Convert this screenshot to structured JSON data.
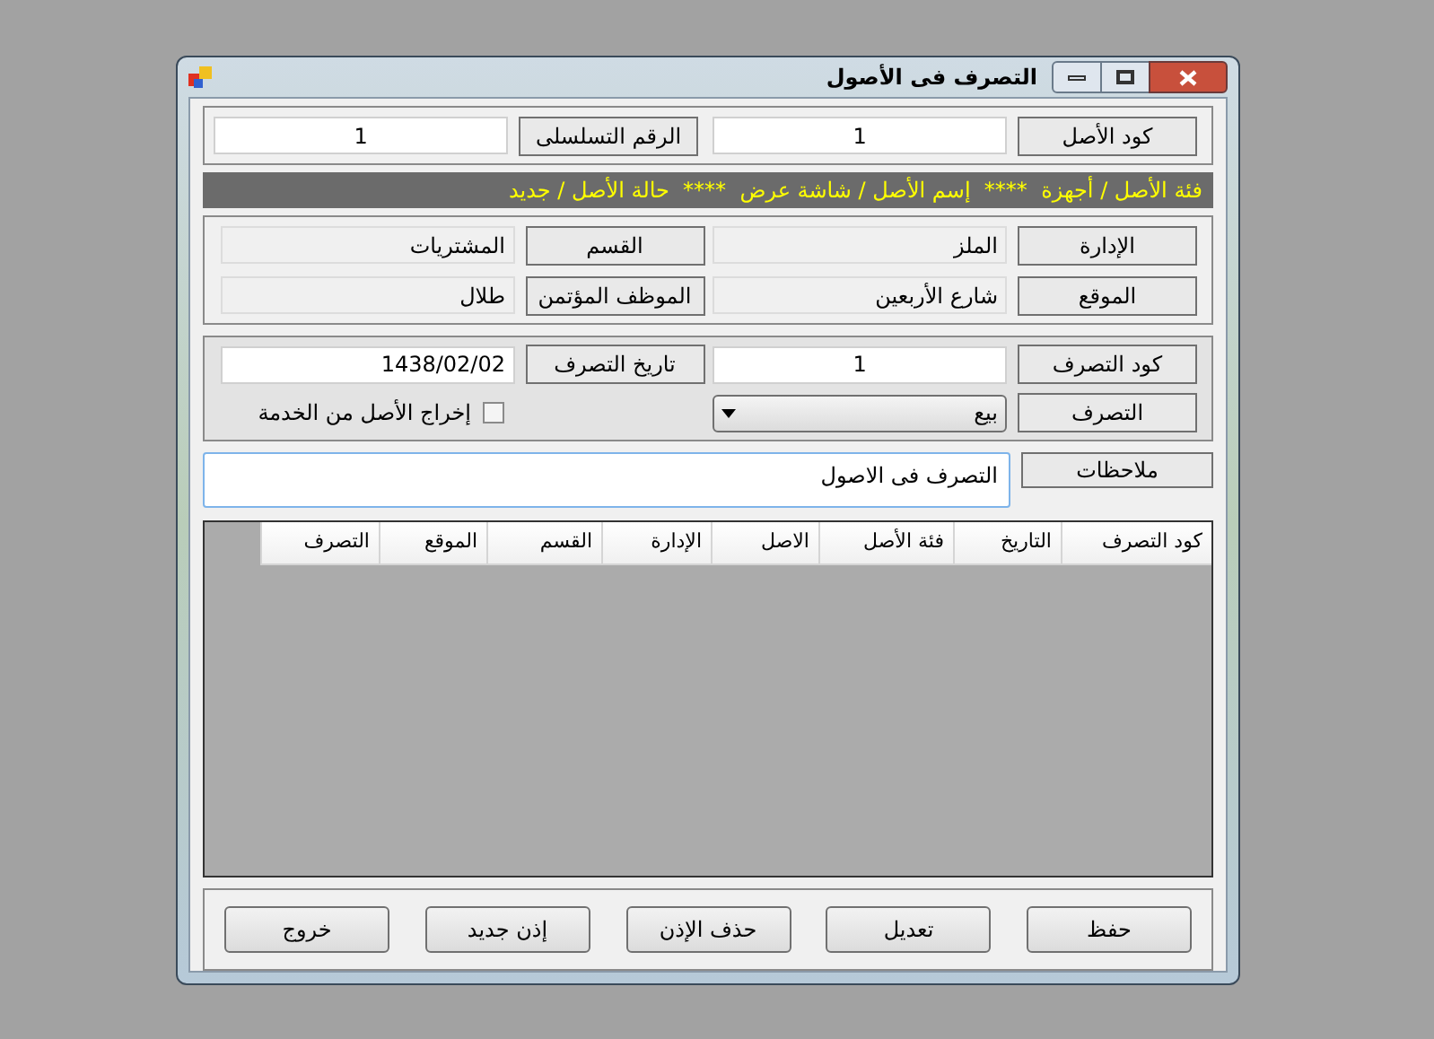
{
  "window": {
    "title": "التصرف فى الأصول"
  },
  "asset": [
    {
      "label": "كود الأصل",
      "value": "1"
    },
    {
      "label": "الرقم التسلسلى",
      "value": "1"
    }
  ],
  "banner": "فئة الأصل / أجهزة  ****  إسم الأصل / شاشة عرض  ****  حالة الأصل / جديد",
  "details": [
    {
      "label": "الإدارة",
      "value": "الملز"
    },
    {
      "label": "القسم",
      "value": "المشتريات"
    },
    {
      "label": "الموقع",
      "value": "شارع الأربعين"
    },
    {
      "label": "الموظف المؤتمن",
      "value": "طلال"
    }
  ],
  "disposal": {
    "code": {
      "label": "كود التصرف",
      "value": "1"
    },
    "date": {
      "label": "تاريخ التصرف",
      "value": "1438/02/02"
    },
    "type": {
      "label": "التصرف",
      "value": "بيع"
    },
    "out_of_service": {
      "label": "إخراج الأصل من الخدمة",
      "checked": false
    }
  },
  "notes": {
    "label": "ملاحظات",
    "value": "التصرف فى الاصول"
  },
  "table": {
    "columns": [
      "كود التصرف",
      "التاريخ",
      "فئة الأصل",
      "الاصل",
      "الإدارة",
      "القسم",
      "الموقع",
      "التصرف"
    ]
  },
  "buttons": [
    "حفظ",
    "تعديل",
    "حذف الإذن",
    "إذن جديد",
    "خروج"
  ]
}
